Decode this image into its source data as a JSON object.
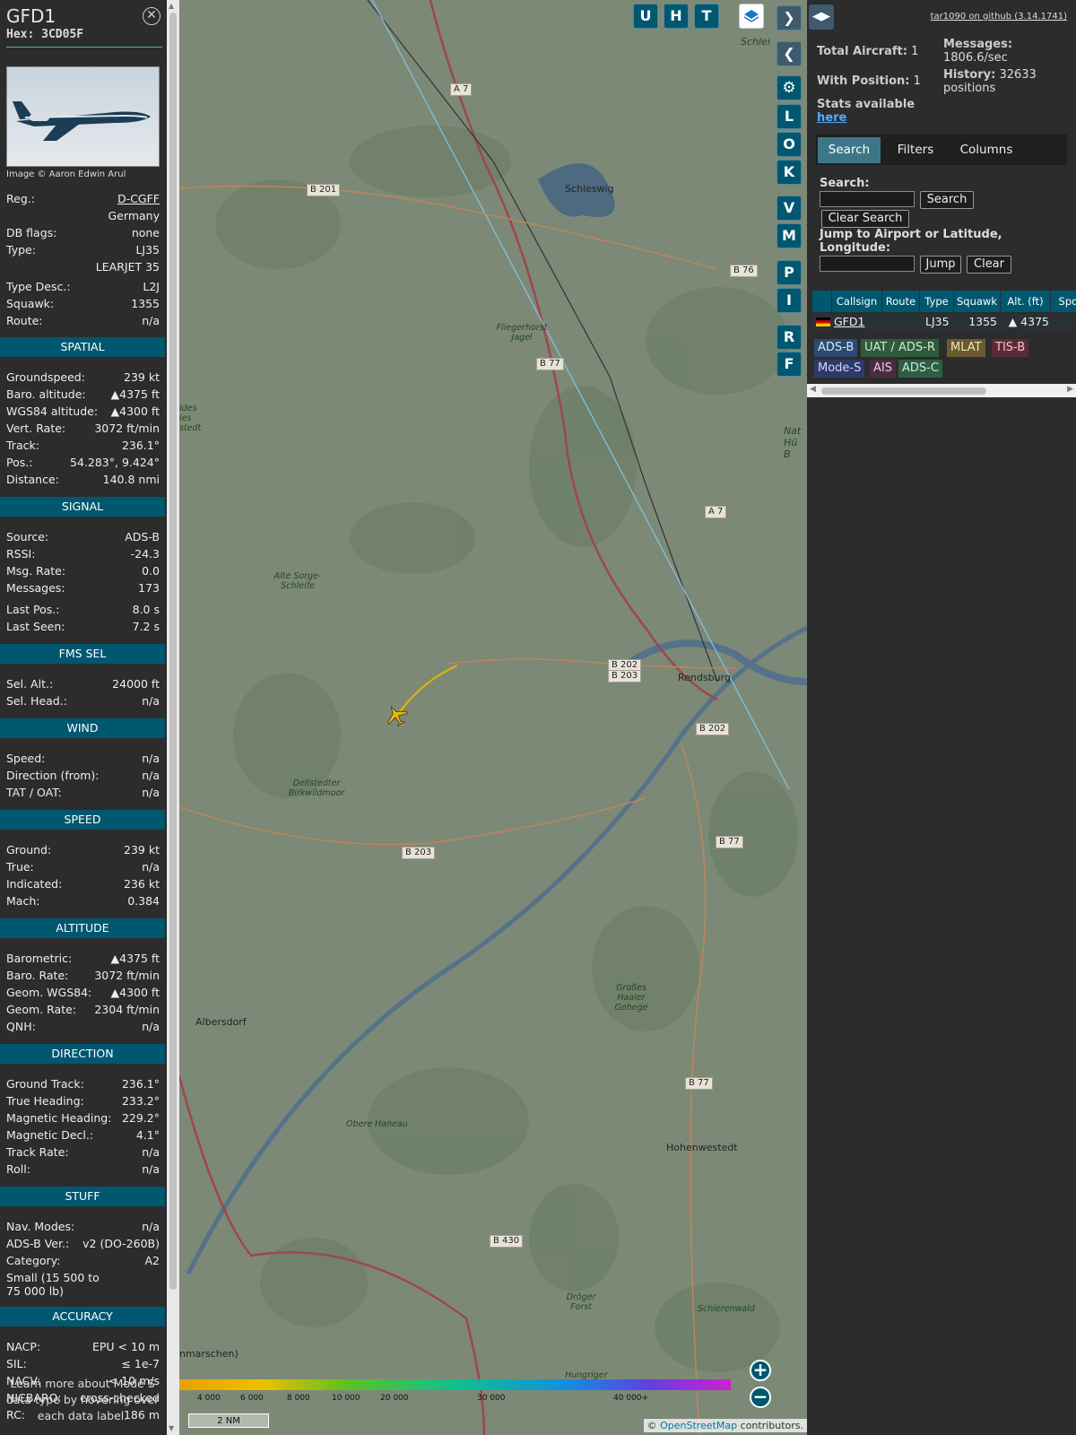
{
  "aircraft": {
    "callsign": "GFD1",
    "hex_label": "Hex:",
    "hex": "3CD05F",
    "photo_credit": "Image © Aaron Edwin Arul"
  },
  "info_rows": [
    {
      "k": "Reg.:",
      "v": "D-CGFF"
    },
    {
      "k": "",
      "v": "Germany"
    },
    {
      "k": "DB flags:",
      "v": "none"
    },
    {
      "k": "Type:",
      "v": "LJ35"
    },
    {
      "k": "",
      "v": "LEARJET 35"
    },
    {
      "k": "Type Desc.:",
      "v": "L2J"
    },
    {
      "k": "Squawk:",
      "v": "1355"
    },
    {
      "k": "Route:",
      "v": "n/a"
    }
  ],
  "sections": {
    "spatial": {
      "title": "SPATIAL",
      "rows": [
        {
          "k": "Groundspeed:",
          "v": "239 kt"
        },
        {
          "k": "Baro. altitude:",
          "v": "▲4375 ft"
        },
        {
          "k": "WGS84 altitude:",
          "v": "▲4300 ft"
        },
        {
          "k": "Vert. Rate:",
          "v": "3072 ft/min"
        },
        {
          "k": "Track:",
          "v": "236.1°"
        },
        {
          "k": "Pos.:",
          "v": "54.283°, 9.424°"
        },
        {
          "k": "Distance:",
          "v": "140.8 nmi"
        }
      ]
    },
    "signal": {
      "title": "SIGNAL",
      "rows": [
        {
          "k": "Source:",
          "v": "ADS-B"
        },
        {
          "k": "RSSI:",
          "v": "-24.3"
        },
        {
          "k": "Msg. Rate:",
          "v": "0.0"
        },
        {
          "k": "Messages:",
          "v": "173"
        },
        {
          "k": "Last Pos.:",
          "v": "8.0 s"
        },
        {
          "k": "Last Seen:",
          "v": "7.2 s"
        }
      ]
    },
    "fms": {
      "title": "FMS SEL",
      "rows": [
        {
          "k": "Sel. Alt.:",
          "v": "24000 ft"
        },
        {
          "k": "Sel. Head.:",
          "v": "n/a"
        }
      ]
    },
    "wind": {
      "title": "WIND",
      "rows": [
        {
          "k": "Speed:",
          "v": "n/a"
        },
        {
          "k": "Direction (from):",
          "v": "n/a"
        },
        {
          "k": "TAT / OAT:",
          "v": "n/a"
        }
      ]
    },
    "speed": {
      "title": "SPEED",
      "rows": [
        {
          "k": "Ground:",
          "v": "239 kt"
        },
        {
          "k": "True:",
          "v": "n/a"
        },
        {
          "k": "Indicated:",
          "v": "236 kt"
        },
        {
          "k": "Mach:",
          "v": "0.384"
        }
      ]
    },
    "altitude": {
      "title": "ALTITUDE",
      "rows": [
        {
          "k": "Barometric:",
          "v": "▲4375 ft"
        },
        {
          "k": "Baro. Rate:",
          "v": "3072 ft/min"
        },
        {
          "k": "Geom. WGS84:",
          "v": "▲4300 ft"
        },
        {
          "k": "Geom. Rate:",
          "v": "2304 ft/min"
        },
        {
          "k": "QNH:",
          "v": "n/a"
        }
      ]
    },
    "direction": {
      "title": "DIRECTION",
      "rows": [
        {
          "k": "Ground Track:",
          "v": "236.1°"
        },
        {
          "k": "True Heading:",
          "v": "233.2°"
        },
        {
          "k": "Magnetic Heading:",
          "v": "229.2°"
        },
        {
          "k": "Magnetic Decl.:",
          "v": "4.1°"
        },
        {
          "k": "Track Rate:",
          "v": "n/a"
        },
        {
          "k": "Roll:",
          "v": "n/a"
        }
      ]
    },
    "stuff": {
      "title": "STUFF",
      "rows": [
        {
          "k": "Nav. Modes:",
          "v": "n/a"
        },
        {
          "k": "ADS-B Ver.:",
          "v": "v2 (DO-260B)"
        },
        {
          "k": "Category:",
          "v": "A2"
        },
        {
          "k": "Small (15 500 to 75 000 lb)",
          "v": ""
        }
      ]
    },
    "accuracy": {
      "title": "ACCURACY",
      "rows": [
        {
          "k": "NACP:",
          "v": "EPU < 10 m"
        },
        {
          "k": "SIL:",
          "v": "≤ 1e-7"
        },
        {
          "k": "NACV:",
          "v": "< 10 m/s"
        },
        {
          "k": "NICBARO:",
          "v": "cross-checked"
        },
        {
          "k": "RC:",
          "v": "186 m"
        }
      ]
    }
  },
  "learn_more": "Learn more about Mode S data type by hovering over each data label.",
  "map": {
    "buttons_top": [
      "U",
      "H",
      "T"
    ],
    "buttons_side": [
      "L",
      "O",
      "K",
      "V",
      "M",
      "P",
      "I",
      "R",
      "F"
    ],
    "road_labels": [
      "A 7",
      "B 201",
      "B 76",
      "B 77",
      "A 7",
      "B 202",
      "B 203",
      "B 202",
      "B 77",
      "B 203",
      "B 77",
      "B 430"
    ],
    "towns": [
      "Schleswig",
      "Rendsburg",
      "Albersdorf",
      "Hohenwestedt",
      "nmarschen)",
      "Schlei",
      "Nat Hü B"
    ],
    "woods": [
      "Fliegerhorst Jagel",
      "Alte Sorge-Schleife",
      "Dellstedter Birkwildmoor",
      "Großes Haaler Gehege",
      "Obere Haneau",
      "Dröger Forst",
      "Schierenwald",
      "Hungriger",
      "ldes ies stedt"
    ],
    "altitude_ticks": [
      "4 000",
      "6 000",
      "8 000",
      "10 000",
      "20 000",
      "30 000",
      "40 000+"
    ],
    "scale": "2 NM",
    "attribution_prefix": "© ",
    "attribution_link": "OpenStreetMap",
    "attribution_suffix": " contributors."
  },
  "right": {
    "github": "tar1090 on github (3.14.1741)",
    "total_aircraft_label": "Total Aircraft:",
    "total_aircraft": "1",
    "with_position_label": "With Position:",
    "with_position": "1",
    "stats_label": "Stats available",
    "stats_link": "here",
    "messages_label": "Messages:",
    "messages": "1806.6/sec",
    "history_label": "History:",
    "history_count": "32633",
    "history_unit": "positions",
    "tabs": [
      "Search",
      "Filters",
      "Columns"
    ],
    "search_label": "Search:",
    "search_btn": "Search",
    "clear_search_btn": "Clear Search",
    "jump_label": "Jump to Airport or Latitude, Longitude:",
    "jump_btn": "Jump",
    "clear_btn": "Clear",
    "columns": [
      "Callsign",
      "Route",
      "Type",
      "Squawk",
      "Alt. (ft)",
      "Spd"
    ],
    "row": {
      "callsign": "GFD1",
      "route": "",
      "type": "LJ35",
      "squawk": "1355",
      "alt": "▲ 4375"
    },
    "sources": [
      "ADS-B",
      "UAT / ADS-R",
      "MLAT",
      "TIS-B",
      "Mode-S",
      "AIS",
      "ADS-C"
    ]
  },
  "colors": {
    "section_header": "#005770",
    "panel_bg": "#2c2c2c",
    "aircraft": "#f5b800",
    "trail": "#e8b400"
  }
}
